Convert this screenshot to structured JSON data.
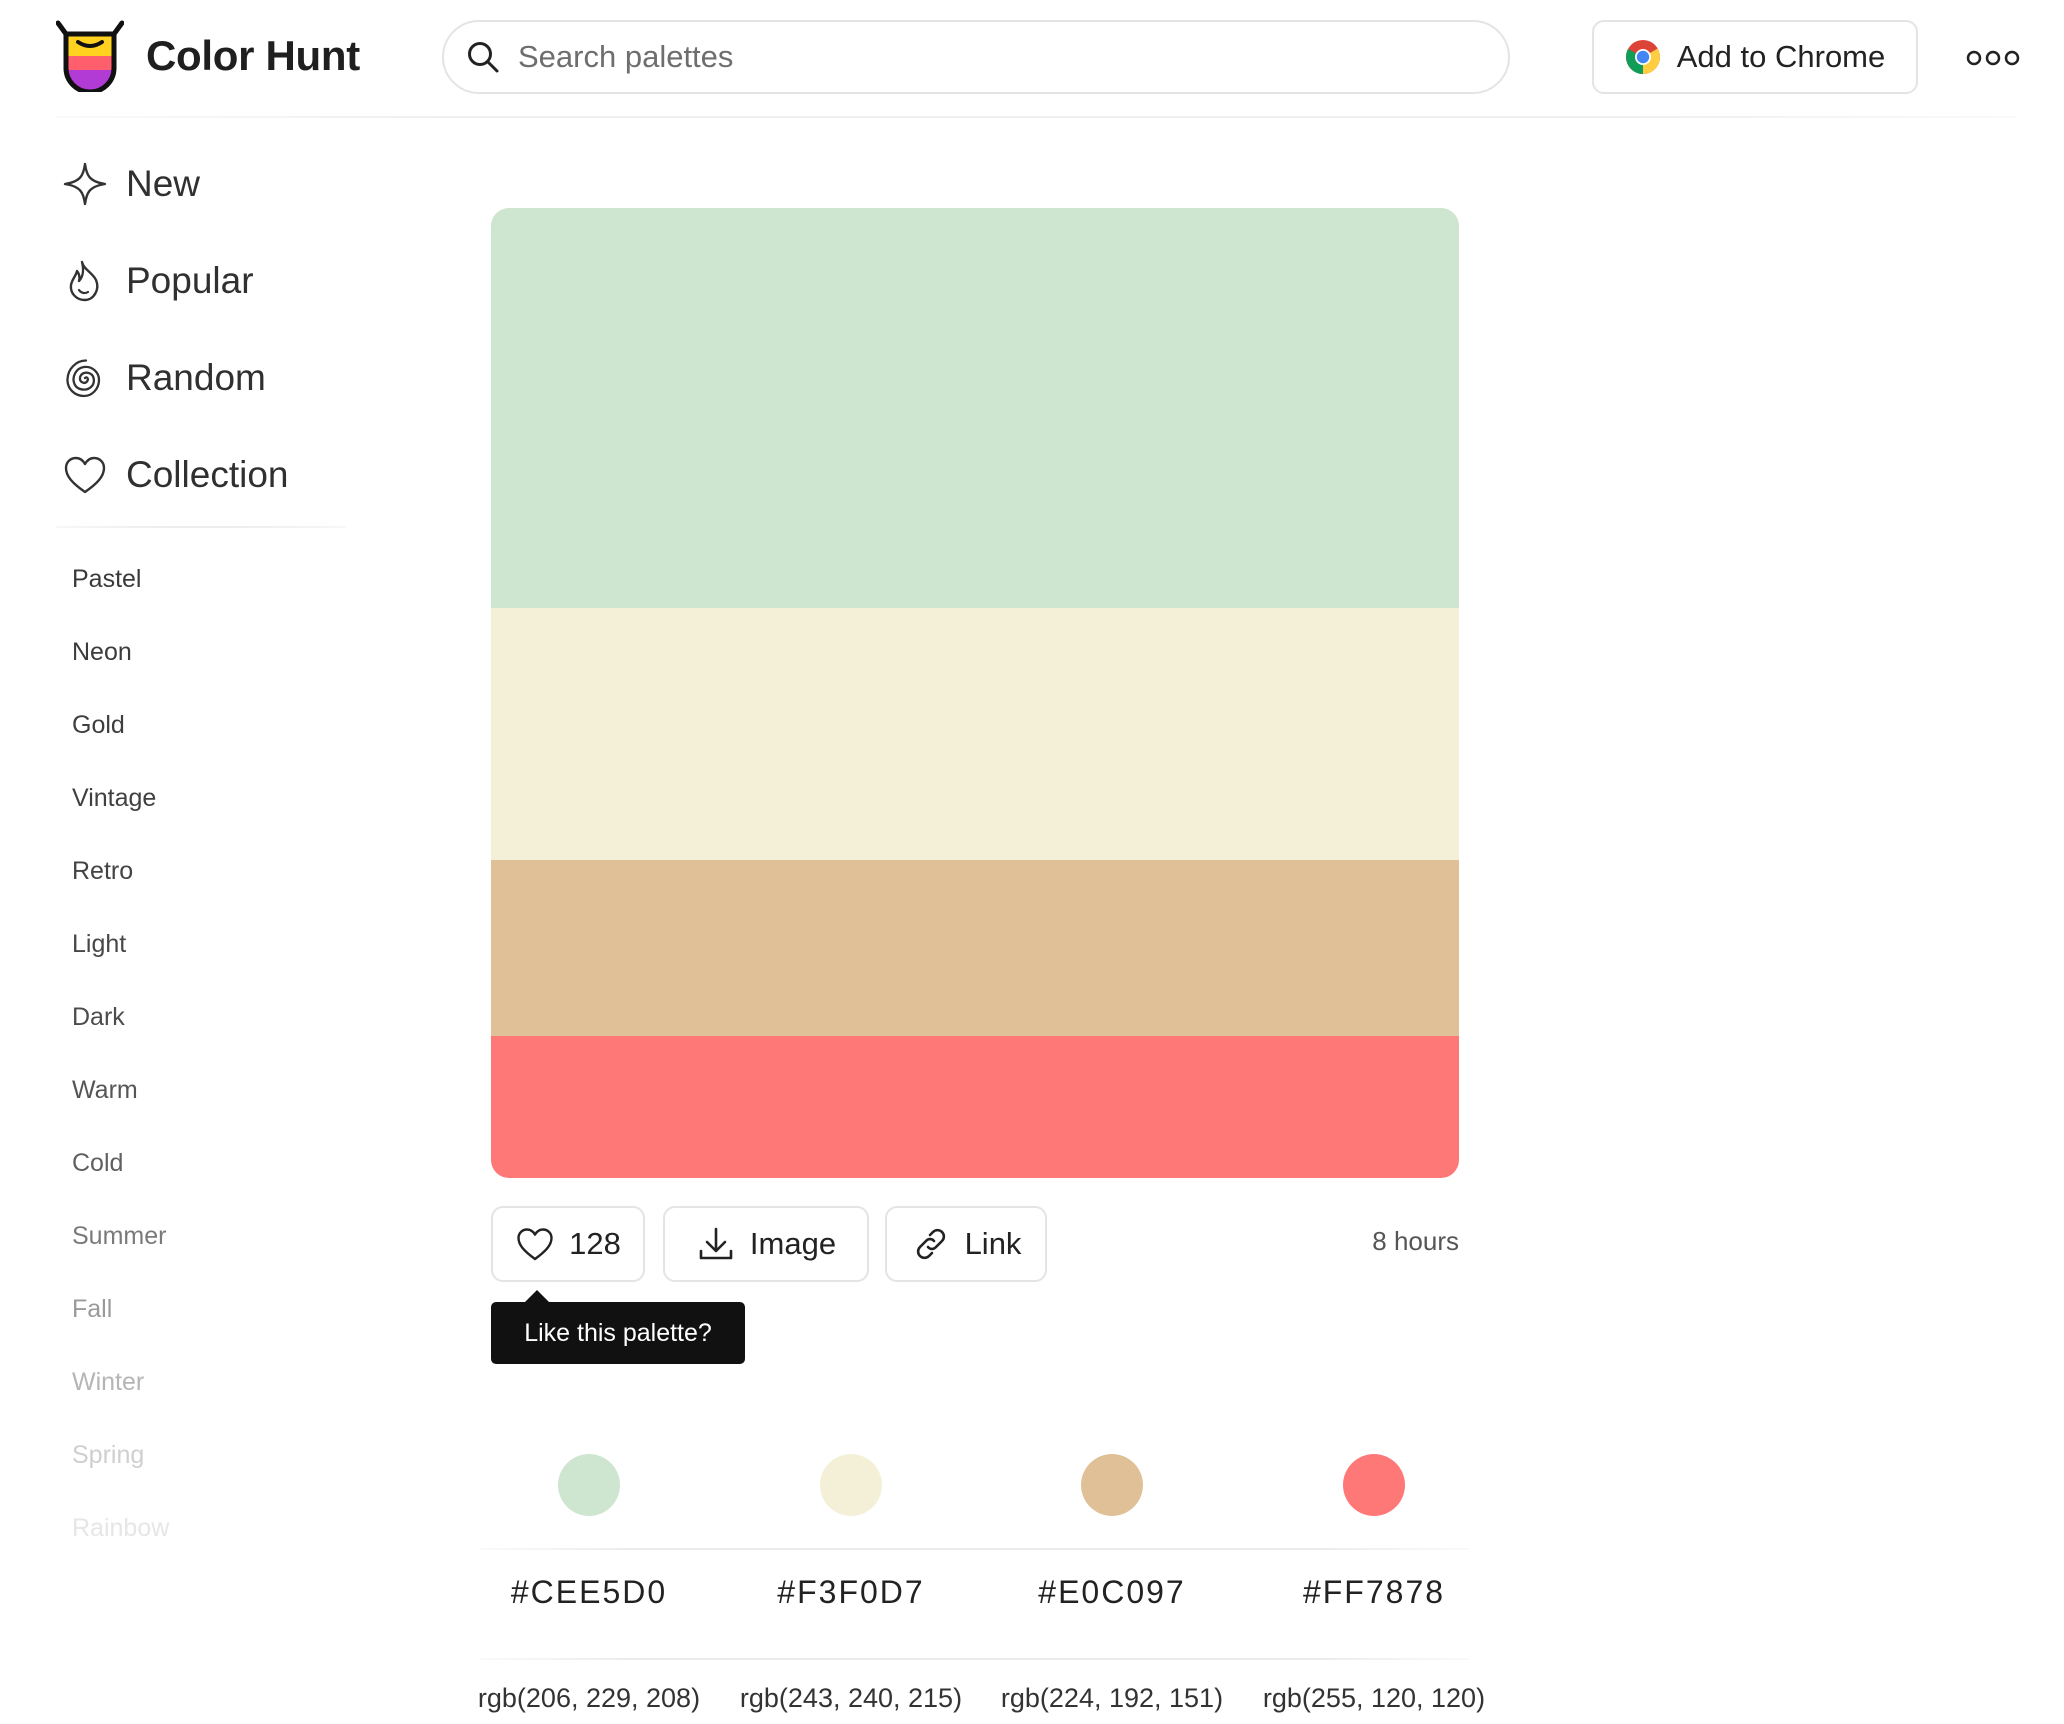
{
  "brand": {
    "name": "Color Hunt"
  },
  "search": {
    "placeholder": "Search palettes",
    "value": ""
  },
  "header": {
    "chrome_label": "Add to Chrome"
  },
  "nav": [
    {
      "label": "New",
      "icon": "sparkle-icon"
    },
    {
      "label": "Popular",
      "icon": "flame-icon"
    },
    {
      "label": "Random",
      "icon": "spiral-icon"
    },
    {
      "label": "Collection",
      "icon": "heart-icon"
    }
  ],
  "tags": [
    "Pastel",
    "Neon",
    "Gold",
    "Vintage",
    "Retro",
    "Light",
    "Dark",
    "Warm",
    "Cold",
    "Summer",
    "Fall",
    "Winter",
    "Spring",
    "Rainbow"
  ],
  "palette": {
    "colors": [
      {
        "hex": "#CEE5D0",
        "rgb": "rgb(206, 229, 208)"
      },
      {
        "hex": "#F3F0D7",
        "rgb": "rgb(243, 240, 215)"
      },
      {
        "hex": "#E0C097",
        "rgb": "rgb(224, 192, 151)"
      },
      {
        "hex": "#FF7878",
        "rgb": "rgb(255, 120, 120)"
      }
    ],
    "likes": "128",
    "image_label": "Image",
    "link_label": "Link",
    "time": "8 hours",
    "tooltip": "Like this palette?"
  }
}
